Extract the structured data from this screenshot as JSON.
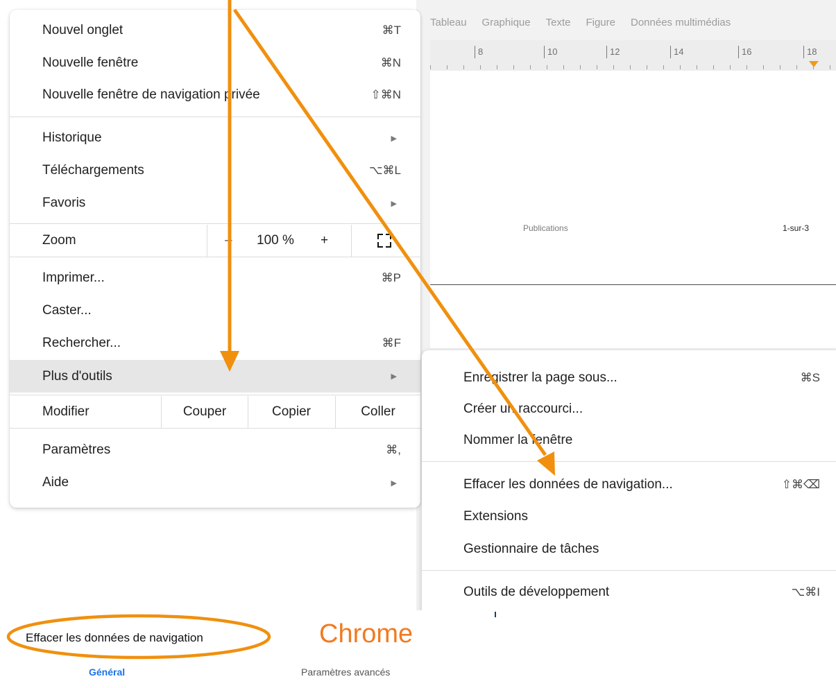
{
  "background_doc": {
    "toolbar": [
      "Tableau",
      "Graphique",
      "Texte",
      "Figure",
      "Données multimédias"
    ],
    "ruler_numbers": [
      "8",
      "10",
      "12",
      "14",
      "16",
      "18"
    ],
    "header_text": "Publications",
    "page_number": "1-sur-3"
  },
  "menu": {
    "new_tab": {
      "label": "Nouvel onglet",
      "shortcut": "⌘T"
    },
    "new_window": {
      "label": "Nouvelle fenêtre",
      "shortcut": "⌘N"
    },
    "new_private_window": {
      "label": "Nouvelle fenêtre de navigation privée",
      "shortcut": "⇧⌘N"
    },
    "history": {
      "label": "Historique"
    },
    "downloads": {
      "label": "Téléchargements",
      "shortcut": "⌥⌘L"
    },
    "bookmarks": {
      "label": "Favoris"
    },
    "zoom": {
      "label": "Zoom",
      "minus": "–",
      "value": "100 %",
      "plus": "+"
    },
    "print": {
      "label": "Imprimer...",
      "shortcut": "⌘P"
    },
    "cast": {
      "label": "Caster..."
    },
    "find": {
      "label": "Rechercher...",
      "shortcut": "⌘F"
    },
    "more_tools": {
      "label": "Plus d'outils"
    },
    "edit": {
      "label": "Modifier",
      "cut": "Couper",
      "copy": "Copier",
      "paste": "Coller"
    },
    "settings": {
      "label": "Paramètres",
      "shortcut": "⌘,"
    },
    "help": {
      "label": "Aide"
    }
  },
  "submenu": {
    "save_page": {
      "label": "Enregistrer la page sous...",
      "shortcut": "⌘S"
    },
    "create_shortcut": {
      "label": "Créer un raccourci..."
    },
    "name_window": {
      "label": "Nommer la fenêtre"
    },
    "clear_browsing": {
      "label": "Effacer les données de navigation...",
      "shortcut": "⇧⌘⌫"
    },
    "extensions": {
      "label": "Extensions"
    },
    "task_manager": {
      "label": "Gestionnaire de tâches"
    },
    "dev_tools": {
      "label": "Outils de développement",
      "shortcut": "⌥⌘I"
    }
  },
  "bottom": {
    "clear_label": "Effacer les données de navigation",
    "brand": "Chrome",
    "tab_general": "Général",
    "tab_advanced": "Paramètres avancés"
  },
  "colors": {
    "annotation": "#f0900e",
    "brand": "#f27a21",
    "link_blue": "#1a73e8",
    "highlight": "#e6e6e6"
  }
}
